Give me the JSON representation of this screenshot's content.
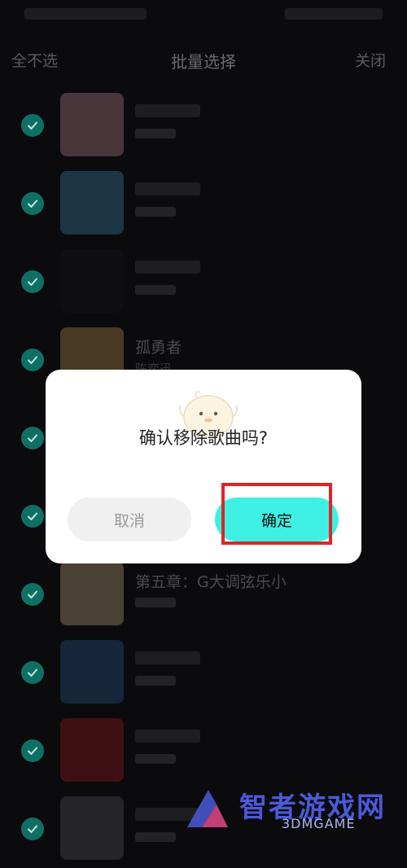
{
  "header": {
    "left_action": "全不选",
    "title": "批量选择",
    "right_action": "关闭"
  },
  "songs": [
    {
      "title": "",
      "subtitle": "",
      "thumb_color": "#e8a9b4",
      "checked": true
    },
    {
      "title": "",
      "subtitle": "",
      "thumb_color": "#4aa7d6",
      "checked": true
    },
    {
      "title": "",
      "subtitle": "",
      "thumb_color": "#1b1b1b",
      "checked": true
    },
    {
      "title": "孤勇者",
      "subtitle": "陈奕迅",
      "thumb_color": "#e9b25a",
      "checked": true
    },
    {
      "title": "",
      "subtitle": "",
      "thumb_color": "#dac9a8",
      "checked": true
    },
    {
      "title": "",
      "subtitle": "",
      "thumb_color": "#e7d7b9",
      "checked": true
    },
    {
      "title": "第五章：G大调弦乐小",
      "subtitle": "",
      "thumb_color": "#e8d29a",
      "checked": true
    },
    {
      "title": "",
      "subtitle": "",
      "thumb_color": "#3a6fb0",
      "checked": true
    },
    {
      "title": "",
      "subtitle": "",
      "thumb_color": "#c82020",
      "checked": true
    },
    {
      "title": "",
      "subtitle": "",
      "thumb_color": "#6a6a6a",
      "checked": true
    }
  ],
  "dialog": {
    "message": "确认移除歌曲吗?",
    "cancel_label": "取消",
    "confirm_label": "确定"
  },
  "colors": {
    "accent": "#3ef0e4",
    "check": "#0f6f63",
    "highlight": "#e02424"
  },
  "watermark": {
    "brand": "智者游戏网",
    "sub": "3DMGAME"
  }
}
